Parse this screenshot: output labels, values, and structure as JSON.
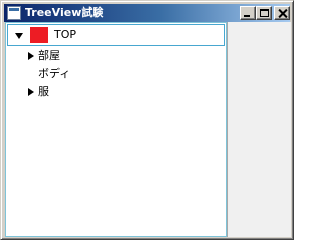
{
  "window": {
    "title": "TreeView試験"
  },
  "tree": {
    "root": {
      "label": "TOP",
      "color": "#ed1c24",
      "expanded": true
    },
    "children": [
      {
        "label": "部屋",
        "has_children": true,
        "expanded": false
      },
      {
        "label": "ボディ",
        "has_children": false,
        "expanded": false
      },
      {
        "label": "服",
        "has_children": true,
        "expanded": false
      }
    ]
  },
  "colors": {
    "titlebar_start": "#0a246a",
    "titlebar_end": "#a6caf0",
    "selection_border": "#48a7d0"
  }
}
